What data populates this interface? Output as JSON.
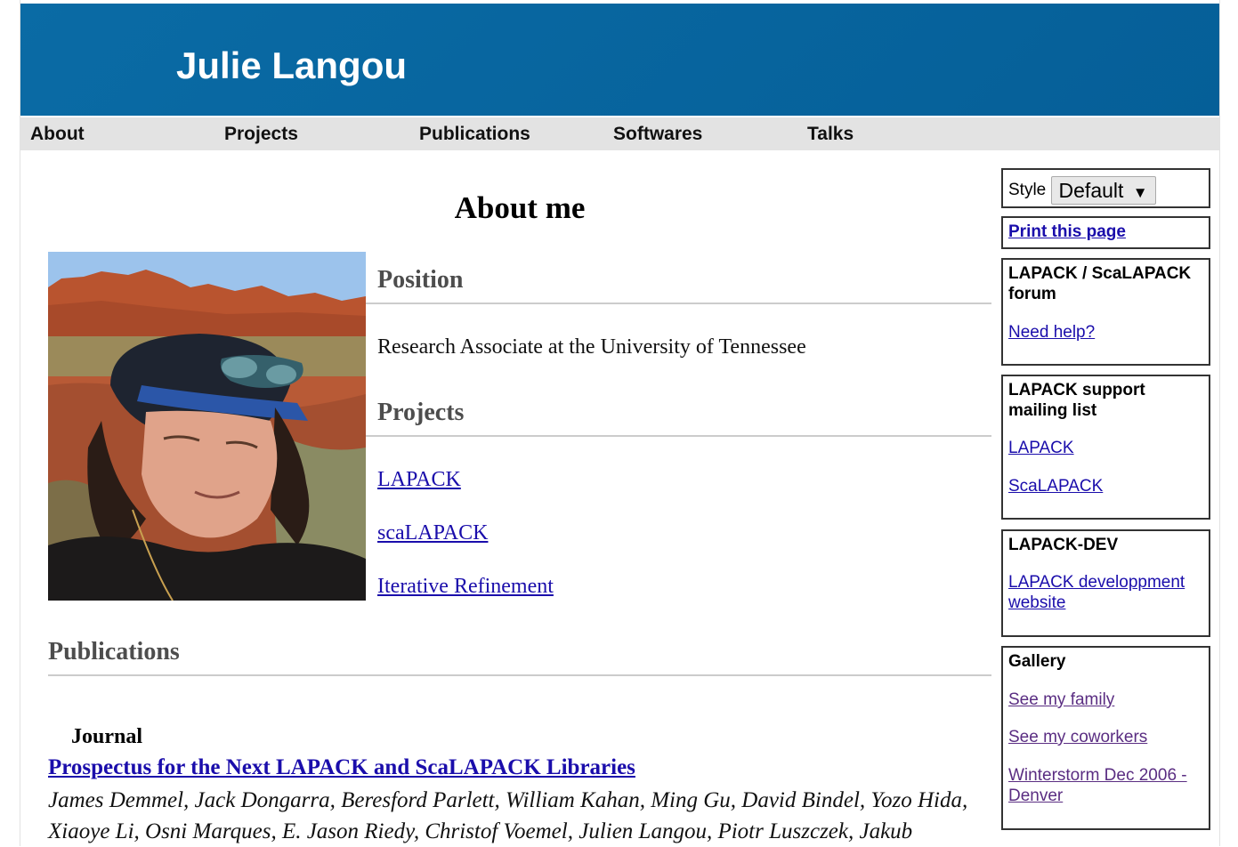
{
  "header": {
    "title": "Julie Langou"
  },
  "nav": {
    "items": [
      "About",
      "Projects",
      "Publications",
      "Softwares",
      "Talks"
    ]
  },
  "main": {
    "heading": "About me",
    "position": {
      "heading": "Position",
      "text": "Research Associate at the University of Tennessee"
    },
    "projects": {
      "heading": "Projects",
      "links": [
        "LAPACK",
        "scaLAPACK",
        "Iterative Refinement"
      ]
    },
    "publications": {
      "heading": "Publications",
      "category": "Journal",
      "items": [
        {
          "title": "Prospectus for the Next LAPACK and ScaLAPACK Libraries",
          "authors": "James Demmel, Jack Dongarra, Beresford Parlett, William Kahan, Ming Gu, David Bindel, Yozo Hida, Xiaoye Li, Osni Marques, E. Jason Riedy, Christof Voemel, Julien Langou, Piotr Luszczek, Jakub"
        }
      ]
    }
  },
  "sidebar": {
    "style": {
      "label": "Style",
      "selected": "Default",
      "arrow": "▼"
    },
    "print_link": "Print this page",
    "forum": {
      "title": "LAPACK / ScaLAPACK forum",
      "link": "Need help?"
    },
    "mailing": {
      "title": "LAPACK support mailing list",
      "links": [
        "LAPACK",
        "ScaLAPACK"
      ]
    },
    "dev": {
      "title": "LAPACK-DEV",
      "link": "LAPACK developpment website"
    },
    "gallery": {
      "title": "Gallery",
      "links": [
        "See my family",
        "See my coworkers",
        "Winterstorm Dec 2006 - Denver"
      ]
    }
  },
  "colors": {
    "header_bg": "#0a6ba5",
    "nav_bg": "#e3e3e3",
    "link": "#1a0dab",
    "visited_link": "#5a2d82",
    "section_heading": "#4d4d4d"
  },
  "images": {
    "photo": "portrait photo of a woman in a dark cap with sunglasses, desert rock formations behind"
  }
}
